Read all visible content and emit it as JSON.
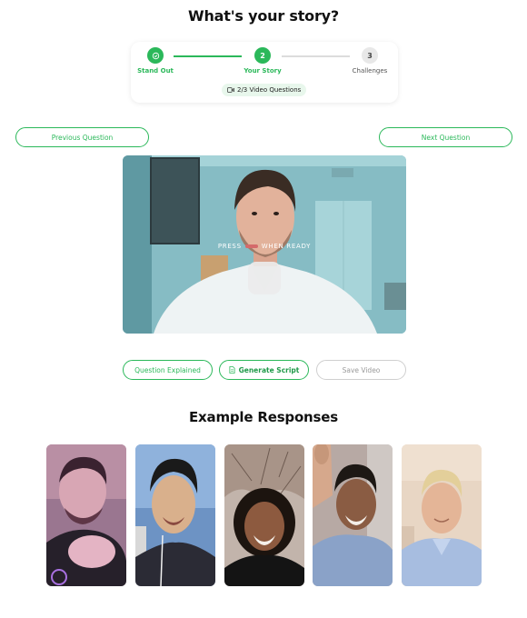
{
  "page": {
    "title": "What's your story?"
  },
  "stepper": {
    "steps": [
      {
        "number": "",
        "label": "Stand Out",
        "state": "done"
      },
      {
        "number": "2",
        "label": "Your Story",
        "state": "active"
      },
      {
        "number": "3",
        "label": "Challenges",
        "state": "todo"
      }
    ],
    "video_questions": "2/3 Video Questions",
    "video_icon": "video-camera-icon"
  },
  "nav": {
    "previous_label": "Previous Question",
    "next_label": "Next Question"
  },
  "recorder": {
    "press_before": "PRESS",
    "press_after": "WHEN READY",
    "record_icon": "record-button"
  },
  "actions": {
    "question_explained": "Question Explained",
    "generate_script": "Generate Script",
    "generate_icon": "document-icon",
    "save_video": "Save Video"
  },
  "examples": {
    "title": "Example Responses",
    "thumbnails": [
      "example-response-1",
      "example-response-2",
      "example-response-3",
      "example-response-4",
      "example-response-5"
    ]
  },
  "colors": {
    "accent": "#2bb85a",
    "accent_light": "#e8f7ec",
    "inactive": "#dcdcdc",
    "text": "#111111"
  }
}
